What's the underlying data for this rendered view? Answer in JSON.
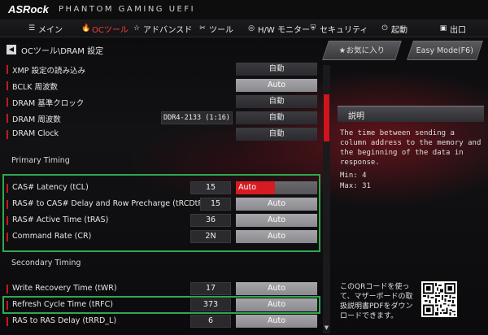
{
  "header": {
    "brand": "ASRock",
    "subtitle": "PHANTOM GAMING UEFI"
  },
  "nav": [
    {
      "label": "メイン",
      "icon": "menu-icon"
    },
    {
      "label": "OCツール",
      "icon": "flame-icon",
      "active": true
    },
    {
      "label": "アドバンスド",
      "icon": "star-icon"
    },
    {
      "label": "ツール",
      "icon": "tools-icon"
    },
    {
      "label": "H/W モニター",
      "icon": "monitor-icon"
    },
    {
      "label": "セキュリティ",
      "icon": "shield-icon"
    },
    {
      "label": "起動",
      "icon": "power-icon"
    },
    {
      "label": "出口",
      "icon": "exit-icon"
    }
  ],
  "breadcrumb": "OCツール\\DRAM 設定",
  "buttons": {
    "favorites": "お気に入り",
    "easy_mode": "Easy Mode(F6)"
  },
  "settings": [
    {
      "label": "XMP 設定の読み込み",
      "option": "自動"
    },
    {
      "label": "BCLK 周波数",
      "option": "Auto"
    },
    {
      "label": "DRAM 基準クロック",
      "option": "自動"
    },
    {
      "label": "DRAM 周波数",
      "current": "DDR4-2133 (1:16)",
      "option": "自動"
    },
    {
      "label": "DRAM Clock",
      "option": "自動"
    }
  ],
  "primary_title": "Primary Timing",
  "primary": [
    {
      "label": "CAS# Latency (tCL)",
      "current": "15",
      "option": "Auto",
      "selected": true
    },
    {
      "label": "RAS# to CAS# Delay and Row Precharge (tRCDtRP)",
      "current": "15",
      "option": "Auto"
    },
    {
      "label": "RAS# Active Time (tRAS)",
      "current": "36",
      "option": "Auto"
    },
    {
      "label": "Command Rate (CR)",
      "current": "2N",
      "option": "Auto"
    }
  ],
  "secondary_title": "Secondary Timing",
  "secondary": [
    {
      "label": "Write Recovery Time (tWR)",
      "current": "17",
      "option": "Auto"
    },
    {
      "label": "Refresh Cycle Time (tRFC)",
      "current": "373",
      "option": "Auto"
    },
    {
      "label": "RAS to RAS Delay (tRRD_L)",
      "current": "6",
      "option": "Auto"
    }
  ],
  "description": {
    "title": "説明",
    "text": "The time between sending a column address to the memory and the beginning of the data in response.",
    "min": "Min: 4",
    "max": "Max: 31"
  },
  "qr_text": "このQRコードを使って、マザーボードの取扱説明書PDFをダウンロードできます。",
  "colors": {
    "accent": "#d61c22",
    "highlight_box": "#2fa84f"
  }
}
